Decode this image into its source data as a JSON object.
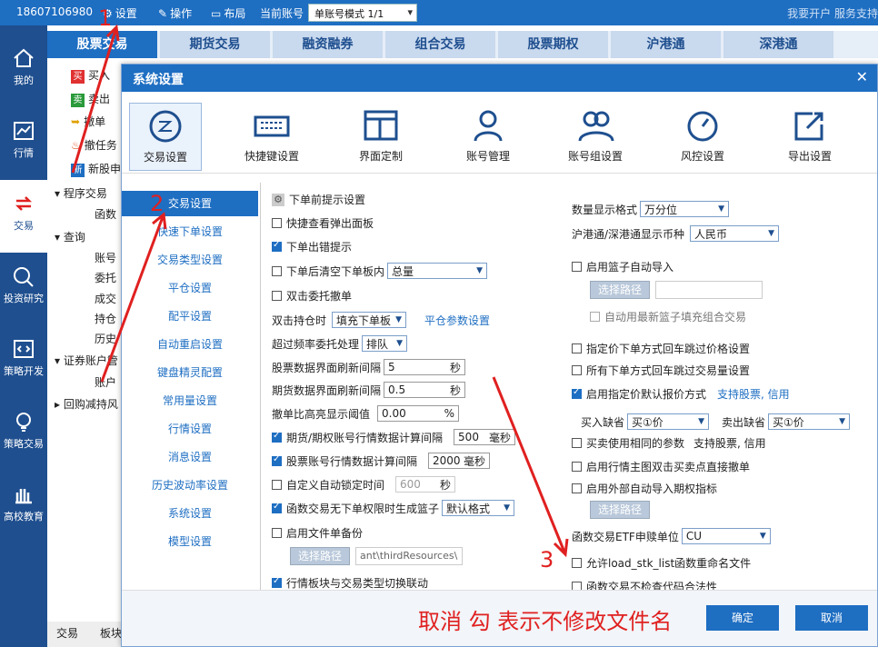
{
  "topbar": {
    "phone": "18607106980",
    "settings": "设置",
    "operate": "操作",
    "layout": "布局",
    "account_label": "当前账号",
    "account_mode": "单账号模式 1/1",
    "right_text": "我要开户 服务支持"
  },
  "sidebar": {
    "items": [
      {
        "label": "我的",
        "icon": "home-icon"
      },
      {
        "label": "行情",
        "icon": "chart-icon"
      },
      {
        "label": "交易",
        "icon": "trade-icon"
      },
      {
        "label": "投资研究",
        "icon": "research-icon"
      },
      {
        "label": "策略开发",
        "icon": "code-icon"
      },
      {
        "label": "策略交易",
        "icon": "bulb-icon"
      },
      {
        "label": "高校教育",
        "icon": "school-icon"
      }
    ]
  },
  "tabs": [
    "股票交易",
    "期货交易",
    "融资融券",
    "组合交易",
    "股票期权",
    "沪港通",
    "深港通"
  ],
  "tree": {
    "buy": "买入",
    "buy_b": "买",
    "sell": "卖出",
    "sell_b": "卖",
    "cancel": "撤单",
    "cancel_task": "撤任务",
    "ipo": "新股申",
    "ipo_b": "新",
    "program": "程序交易",
    "func": "函数",
    "query": "查询",
    "account": "账号",
    "entrust": "委托",
    "deal": "成交",
    "hold": "持仓",
    "history": "历史",
    "securities": "证券账户管",
    "acct2": "账户",
    "buyback": "回购减持风"
  },
  "bottomtabs": [
    "交易",
    "板块"
  ],
  "dialog": {
    "title": "系统设置",
    "icons": [
      "交易设置",
      "快捷键设置",
      "界面定制",
      "账号管理",
      "账号组设置",
      "风控设置",
      "导出设置"
    ],
    "menu": [
      "交易设置",
      "快速下单设置",
      "交易类型设置",
      "平仓设置",
      "配平设置",
      "自动重启设置",
      "键盘精灵配置",
      "常用量设置",
      "行情设置",
      "消息设置",
      "历史波动率设置",
      "系统设置",
      "模型设置"
    ],
    "left": {
      "section": "下单前提示设置",
      "c1": "快捷查看弹出面板",
      "c2": "下单出错提示",
      "c3": "下单后清空下单板内",
      "c3_sel": "总量",
      "c4": "双击委托撤单",
      "dbl_label": "双击持仓时",
      "dbl_sel": "填充下单板",
      "dbl_link": "平仓参数设置",
      "freq_label": "超过频率委托处理",
      "freq_sel": "排队",
      "stock_refresh": "股票数据界面刷新间隔",
      "stock_refresh_v": "5",
      "unit_s": "秒",
      "fut_refresh": "期货数据界面刷新间隔",
      "fut_refresh_v": "0.5",
      "cancel_ratio": "撤单比高亮显示阈值",
      "cancel_ratio_v": "0.00",
      "pct": "%",
      "opt_calc": "期货/期权账号行情数据计算间隔",
      "opt_calc_v": "500",
      "unit_ms": "毫秒",
      "stk_calc": "股票账号行情数据计算间隔",
      "stk_calc_v": "2000",
      "auto_lock": "自定义自动锁定时间",
      "auto_lock_v": "600",
      "func_basket": "函数交易无下单权限时生成篮子",
      "func_basket_sel": "默认格式",
      "file_backup": "启用文件单备份",
      "path_btn": "选择路径",
      "path_v": "ant\\thirdResources\\",
      "linkage": "行情板块与交易类型切换联动"
    },
    "right": {
      "num_fmt": "数量显示格式",
      "num_fmt_sel": "万分位",
      "hk_cur": "沪港通/深港通显示币种",
      "hk_cur_sel": "人民币",
      "basket_import": "启用篮子自动导入",
      "path_btn": "选择路径",
      "auto_use": "自动用最新篮子填充组合交易",
      "limit_skip": "指定价下单方式回车跳过价格设置",
      "all_skip": "所有下单方式回车跳过交易量设置",
      "default_price": "启用指定价默认报价方式",
      "default_price_link": "支持股票, 信用",
      "buy_gap": "买入缺省",
      "buy_gap_sel": "买①价",
      "sell_gap": "卖出缺省",
      "sell_gap_sel": "买①价",
      "same_param": "买卖使用相同的参数",
      "same_param_note": "支持股票, 信用",
      "dbl_click": "启用行情主图双击买卖点直接撤单",
      "ext_import": "启用外部自动导入期权指标",
      "etf_unit": "函数交易ETF申赎单位",
      "etf_unit_sel": "CU",
      "allow_rename": "允许load_stk_list函数重命名文件",
      "no_check": "函数交易不检查代码合法性"
    },
    "ok": "确定",
    "cancel": "取消"
  },
  "annotation": {
    "text": "取消 勾 表示不修改文件名",
    "n1": "1",
    "n2": "2",
    "n3": "3"
  },
  "colors": {
    "primary": "#1e6ec2",
    "sidebar": "#1f4f8f",
    "annot": "#e02020"
  }
}
